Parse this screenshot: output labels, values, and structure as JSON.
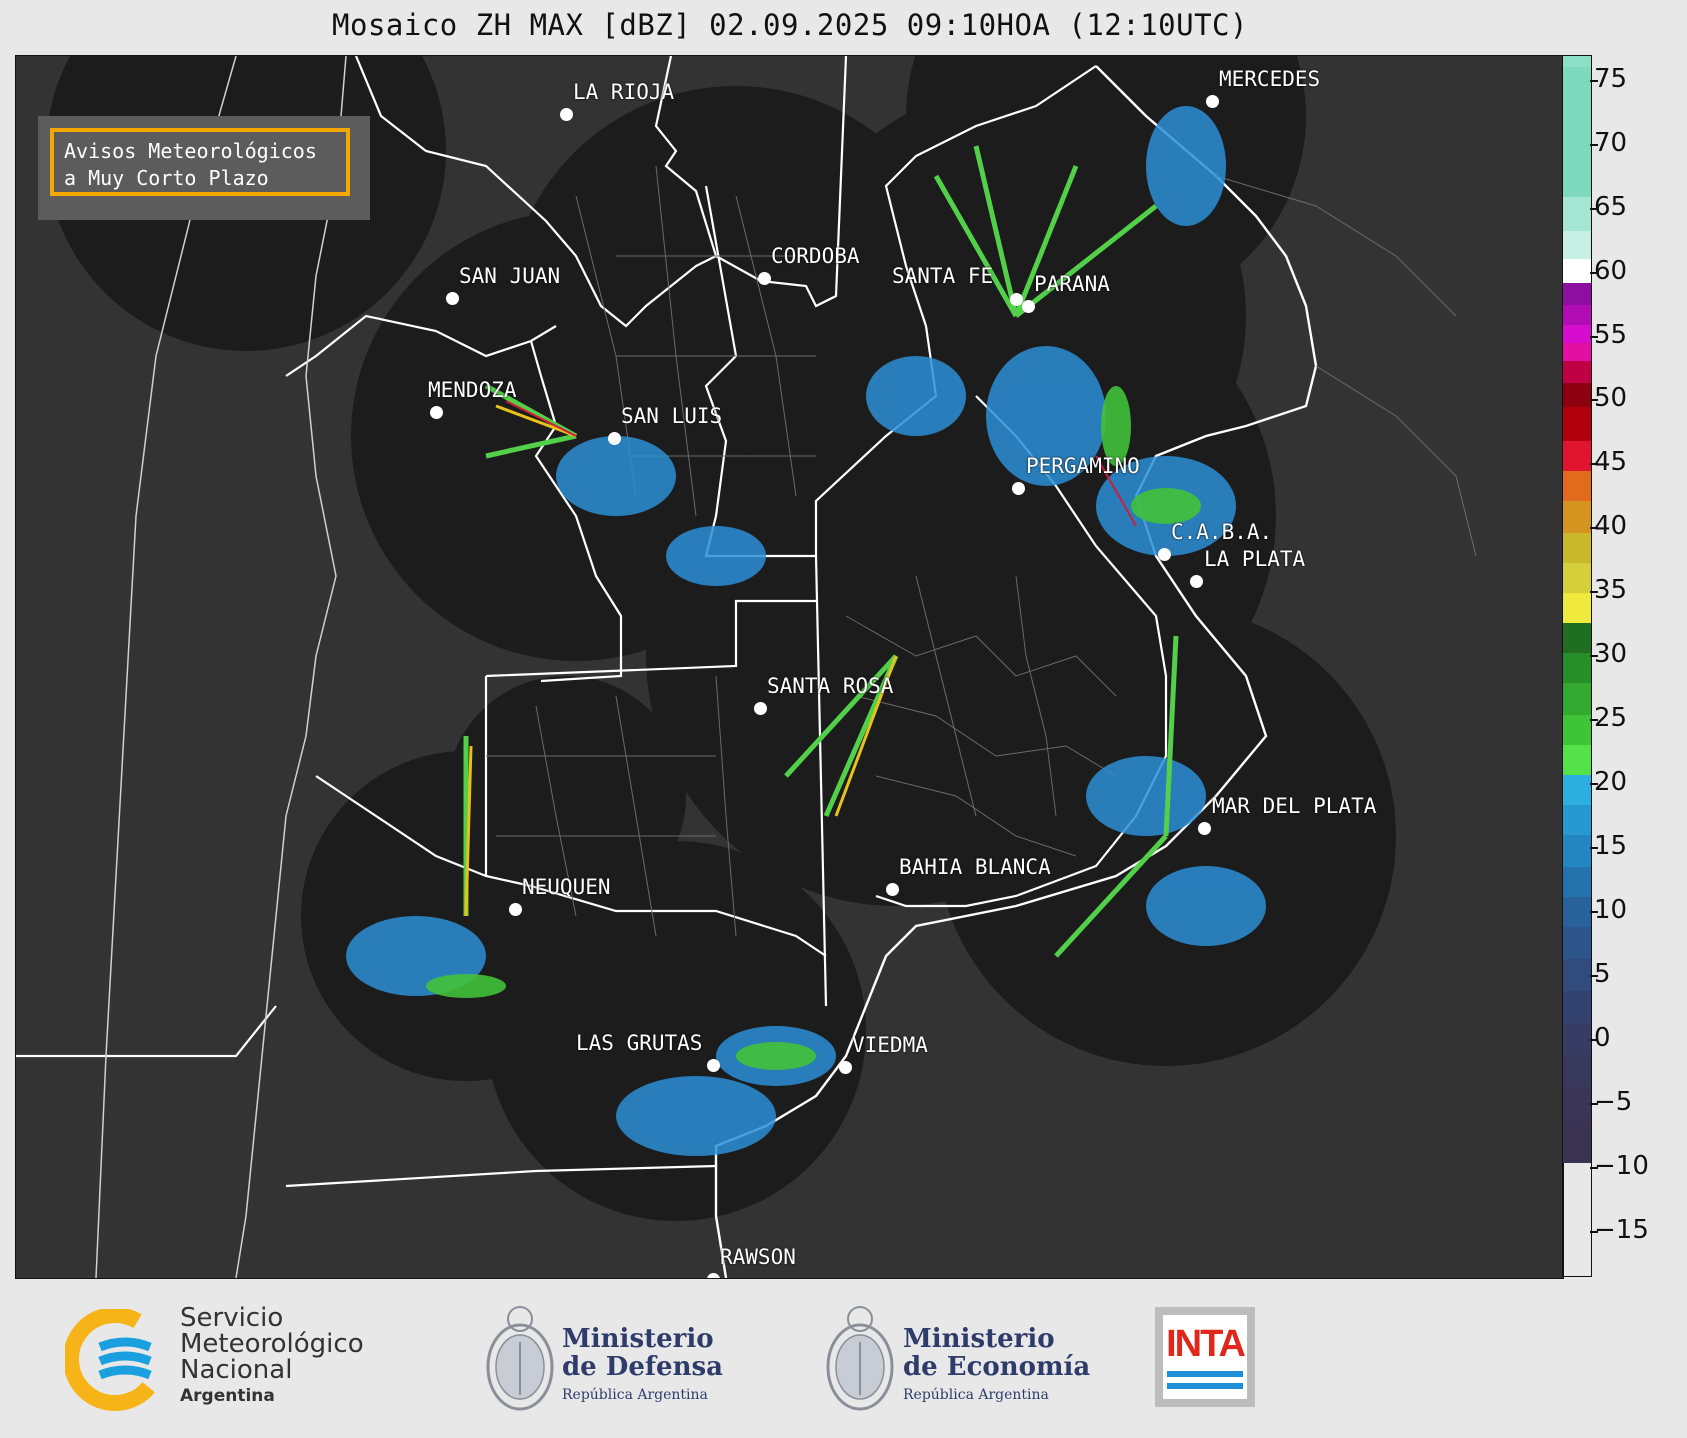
{
  "title": "Mosaico ZH MAX [dBZ] 02.09.2025 09:10HOA (12:10UTC)",
  "alert_box": {
    "line1": "Avisos Meteorológicos",
    "line2": "a Muy Corto Plazo",
    "border_color": "#f5a800"
  },
  "cities": [
    {
      "name": "LA RIOJA"
    },
    {
      "name": "SAN JUAN"
    },
    {
      "name": "CORDOBA"
    },
    {
      "name": "SANTA FE"
    },
    {
      "name": "PARANA"
    },
    {
      "name": "MERCEDES"
    },
    {
      "name": "MENDOZA"
    },
    {
      "name": "SAN LUIS"
    },
    {
      "name": "PERGAMINO"
    },
    {
      "name": "C.A.B.A."
    },
    {
      "name": "LA PLATA"
    },
    {
      "name": "SANTA ROSA"
    },
    {
      "name": "MAR DEL PLATA"
    },
    {
      "name": "BAHIA BLANCA"
    },
    {
      "name": "NEUQUEN"
    },
    {
      "name": "LAS GRUTAS"
    },
    {
      "name": "VIEDMA"
    },
    {
      "name": "RAWSON"
    }
  ],
  "colorbar": {
    "ticks": [
      "75",
      "70",
      "65",
      "60",
      "55",
      "50",
      "45",
      "40",
      "35",
      "30",
      "25",
      "20",
      "15",
      "10",
      "5",
      "0",
      "−5",
      "−10",
      "−15"
    ],
    "range": [
      -18.5,
      77
    ]
  },
  "logos": {
    "smn": {
      "line1": "Servicio",
      "line2": "Meteorológico",
      "line3": "Nacional",
      "line4": "Argentina"
    },
    "defensa": {
      "line1": "Ministerio",
      "line2": "de Defensa",
      "line3": "República Argentina"
    },
    "economia": {
      "line1": "Ministerio",
      "line2": "de Economía",
      "line3": "República Argentina"
    },
    "inta": {
      "text": "INTA"
    }
  }
}
